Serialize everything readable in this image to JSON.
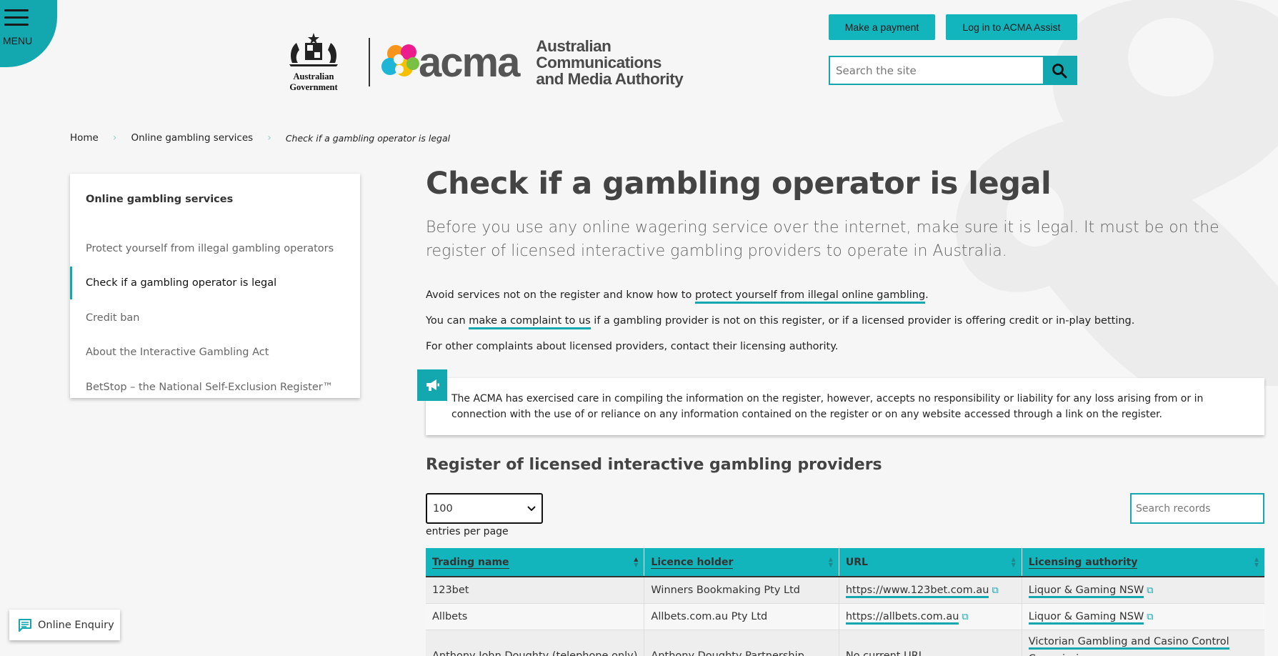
{
  "header": {
    "menu_label": "MENU",
    "gov_label": "Australian Government",
    "logo_word": "acma",
    "logo_full": [
      "Australian",
      "Communications",
      "and Media Authority"
    ],
    "payment_button": "Make a payment",
    "login_button": "Log in to ACMA Assist",
    "search_placeholder": "Search the site"
  },
  "breadcrumb": {
    "home": "Home",
    "section": "Online gambling services",
    "current": "Check if a gambling operator is legal",
    "separator": "›"
  },
  "sidenav": {
    "title": "Online gambling services",
    "items": [
      {
        "label": "Protect yourself from illegal gambling operators",
        "active": false
      },
      {
        "label": "Check if a gambling operator is legal",
        "active": true
      },
      {
        "label": "Credit ban",
        "active": false
      },
      {
        "label": "About the Interactive Gambling Act",
        "active": false
      },
      {
        "label": "BetStop – the National Self-Exclusion Register™",
        "active": false
      }
    ]
  },
  "main": {
    "title": "Check if a gambling operator is legal",
    "lead": "Before you use any online wagering service over the internet, make sure it is legal. It must be on the register of licensed interactive gambling providers to operate in Australia.",
    "p1_before": "Avoid services not on the register and know how to ",
    "p1_link": "protect yourself from illegal online gambling",
    "p1_after": ".",
    "p2_before": "You can ",
    "p2_link": "make a complaint to us",
    "p2_after": " if a gambling provider is not on this register, or if a licensed provider is offering credit or in-play betting.",
    "p3": "For other complaints about licensed providers, contact their licensing authority.",
    "notice": "The ACMA has exercised care in compiling the information on the register, however, accepts no responsibility or liability for any loss arising from or in connection with the use of or reliance on any information contained on the register or on any website accessed through a link on the register.",
    "register_title": "Register of licensed interactive gambling providers",
    "entries_value": "100",
    "entries_label": "entries per page",
    "records_placeholder": "Search records"
  },
  "table": {
    "headers": [
      "Trading name",
      "Licence holder",
      "URL",
      "Licensing authority"
    ],
    "rows": [
      {
        "trading": "123bet",
        "holder": "Winners Bookmaking Pty Ltd",
        "url": "https://www.123bet.com.au",
        "authority": "Liquor & Gaming NSW"
      },
      {
        "trading": "Allbets",
        "holder": "Allbets.com.au Pty Ltd",
        "url": "https://allbets.com.au",
        "authority": "Liquor & Gaming NSW"
      },
      {
        "trading": "Anthony John Doughty (telephone only)",
        "holder": "Anthony Doughty Partnership",
        "url": "No current URL",
        "authority": "Victorian Gambling and Casino Control Commission"
      }
    ]
  },
  "enquiry": {
    "label": "Online Enquiry"
  },
  "colors": {
    "accent": "#13a8b0",
    "button": "#13b5bd",
    "background": "#f6f6f6"
  }
}
